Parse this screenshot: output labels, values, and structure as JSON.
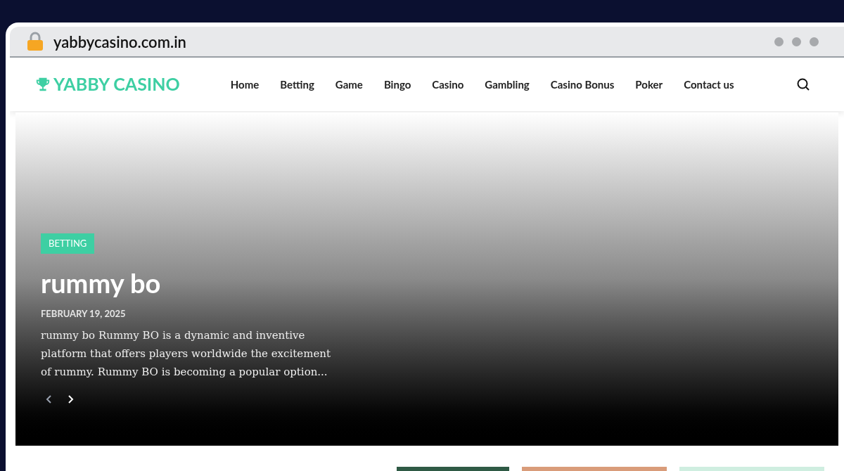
{
  "address_bar": {
    "url": "yabbycasino.com.in"
  },
  "site": {
    "logo": "YABBY CASINO"
  },
  "nav": [
    {
      "label": "Home"
    },
    {
      "label": "Betting"
    },
    {
      "label": "Game"
    },
    {
      "label": "Bingo"
    },
    {
      "label": "Casino"
    },
    {
      "label": "Gambling"
    },
    {
      "label": "Casino Bonus"
    },
    {
      "label": "Poker"
    },
    {
      "label": "Contact us"
    }
  ],
  "hero": {
    "category": "BETTING",
    "title": "rummy bo",
    "date": "FEBRUARY 19, 2025",
    "excerpt": "rummy bo Rummy BO is a dynamic and inventive platform that offers players worldwide the excitement of rummy. Rummy BO is becoming a popular option...",
    "arrows": [
      {
        "kind": "prev",
        "disabled": true
      },
      {
        "kind": "next",
        "disabled": false
      }
    ]
  }
}
